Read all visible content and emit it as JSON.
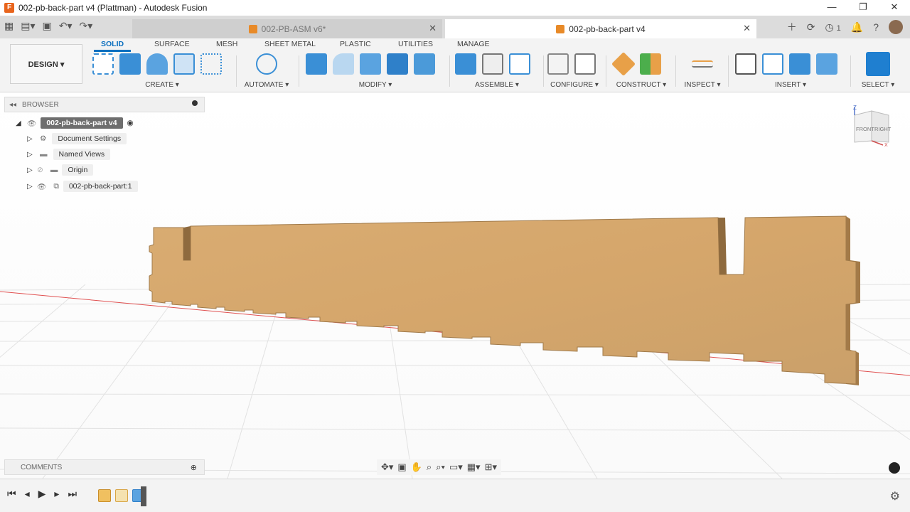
{
  "window": {
    "title": "002-pb-back-part v4 (Plattman) - Autodesk Fusion",
    "controls": [
      "—",
      "❐",
      "✕"
    ]
  },
  "tabs": [
    {
      "label": "002-PB-ASM v6*",
      "active": false
    },
    {
      "label": "002-pb-back-part v4",
      "active": true
    }
  ],
  "header_right": {
    "clock_count": "1"
  },
  "ribbon": {
    "workspace": "DESIGN ▾",
    "tabs": [
      "SOLID",
      "SURFACE",
      "MESH",
      "SHEET METAL",
      "PLASTIC",
      "UTILITIES",
      "MANAGE"
    ],
    "groups": [
      "CREATE ▾",
      "AUTOMATE ▾",
      "MODIFY ▾",
      "ASSEMBLE ▾",
      "CONFIGURE ▾",
      "CONSTRUCT ▾",
      "INSPECT ▾",
      "INSERT ▾",
      "SELECT ▾"
    ]
  },
  "browser": {
    "title": "BROWSER",
    "root": "002-pb-back-part v4",
    "items": [
      "Document Settings",
      "Named Views",
      "Origin",
      "002-pb-back-part:1"
    ]
  },
  "viewcube": {
    "front": "FRONT",
    "right": "RIGHT",
    "axis_z": "Z",
    "axis_x": "X"
  },
  "comments": {
    "title": "COMMENTS"
  },
  "colors": {
    "accent": "#0a6fbf",
    "wood": "#d7a86e",
    "grid": "#dcdcdc",
    "axis_red": "#e05050"
  }
}
